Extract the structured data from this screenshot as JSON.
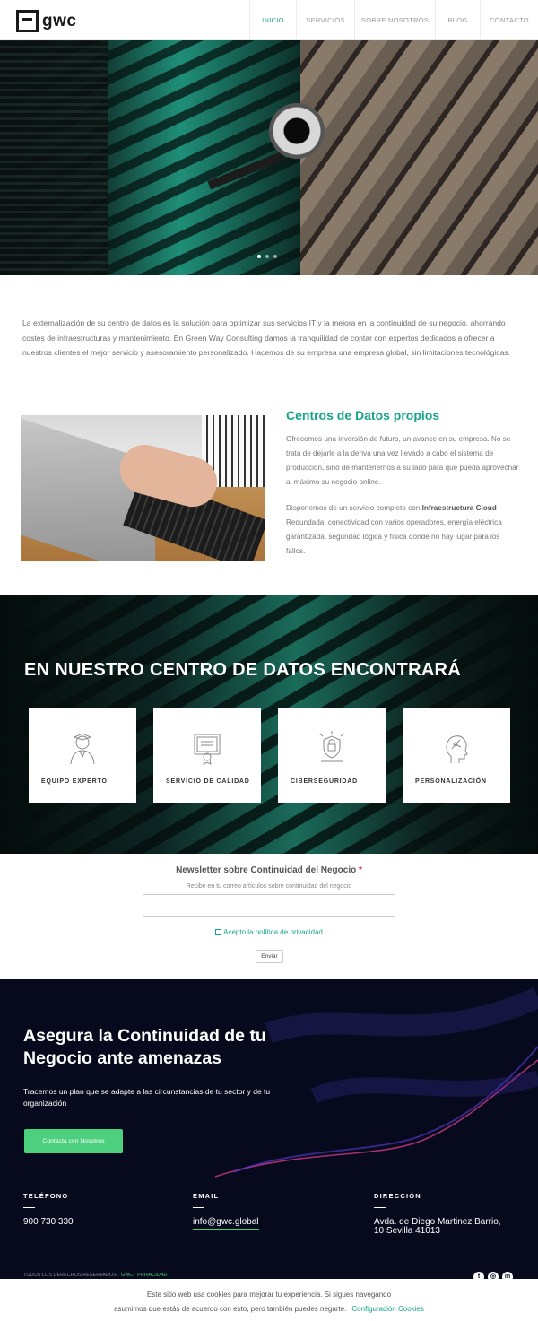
{
  "header": {
    "brand": "gwc",
    "nav": [
      "Inicio",
      "Servicios",
      "Sobre Nosotros",
      "Blog",
      "Contacto"
    ],
    "active_index": 0
  },
  "hero": {
    "slides": 3,
    "current_slide": 1
  },
  "intro": "La externalización de su centro de datos es la solución para optimizar sus servicios IT y la mejora en la continuidad de su negocio, ahorrando costes de infraestructuras y mantenimiento. En Green Way Consulting damos la tranquilidad de contar con expertos dedicados a ofrecer a nuestros clientes el mejor servicio y asesoramiento personalizado. Hacemos de su empresa una empresa global, sin limitaciones tecnológicas.",
  "feature": {
    "title": "Centros de Datos propios",
    "p1": "Ofrecemos una inversión de futuro, un avance en su empresa. No se trata de dejarle a la deriva una vez llevado a cabo el sistema de producción, sino de mantenernos a su lado para que pueda aprovechar al máximo su negocio online.",
    "p2_before": "Disponemos de un servicio completo con",
    "p2_bold": "Infraestructura Cloud",
    "p2_after": "Redundada, conectividad con varios operadores, energía eléctrica garantizada, seguridad lógica y física donde no hay lugar para los fallos."
  },
  "band": {
    "title": "EN NUESTRO CENTRO DE DATOS ENCONTRARÁ",
    "cards": [
      {
        "label": "Equipo experto",
        "icon": "expert-icon"
      },
      {
        "label": "Servicio de calidad",
        "icon": "certificate-icon"
      },
      {
        "label": "Ciberseguridad",
        "icon": "shield-icon"
      },
      {
        "label": "Personalización",
        "icon": "head-icon"
      }
    ]
  },
  "newsletter": {
    "title": "Newsletter sobre Continuidad del Negocio",
    "required_mark": "*",
    "subtitle": "Recibe en tu correo artículos sobre continuidad del negocio",
    "email_value": "",
    "privacy_label": "Acepto la política de privacidad",
    "submit_label": "Enviar"
  },
  "cta": {
    "title": "Asegura la Continuidad de tu Negocio ante amenazas",
    "subtitle": "Tracemos un plan que se adapte a las circunstancias de tu sector y de tu organización",
    "button": "Contacta con Nosotros"
  },
  "contact": {
    "phone_label": "Teléfono",
    "phone": "900 730 330",
    "email_label": "Email",
    "email": "info@gwc.global",
    "address_label": "Dirección",
    "address_line1": "Avda. de Diego Martinez Barrio,",
    "address_line2": "10 Sevilla 41013"
  },
  "footer": {
    "copyright": "Todos los derechos reservados",
    "brand": "GWC",
    "privacy": "Privacidad",
    "socials": [
      "twitter-icon",
      "instagram-icon",
      "linkedin-icon"
    ]
  },
  "cookie": {
    "line1": "Este sitio web usa cookies para mejorar tu experiencia. Si sigues navegando",
    "line2": "asumimos que estás de acuerdo con esto, pero también puedes negarte.",
    "link": "Configuración Cookies"
  },
  "colors": {
    "accent": "#17a589",
    "button_green": "#4cd07d",
    "footer_bg": "#070a1c"
  }
}
